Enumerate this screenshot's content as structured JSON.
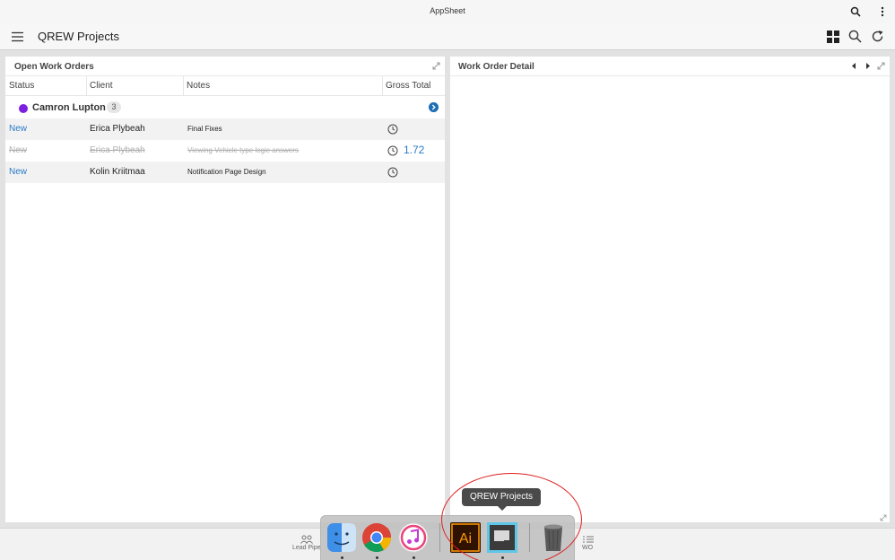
{
  "window": {
    "title": "AppSheet"
  },
  "header": {
    "app_title": "QREW Projects"
  },
  "left_panel": {
    "title": "Open Work Orders",
    "columns": [
      "Status",
      "Client",
      "Notes",
      "Gross Total"
    ],
    "group": {
      "name": "Camron Lupton",
      "count": "3",
      "color": "#7b1fe0"
    },
    "rows": [
      {
        "status": "New",
        "client": "Erica Plybeah",
        "notes": "Final Fixes",
        "gross": ""
      },
      {
        "status": "New",
        "client": "Erica Plybeah",
        "notes": "Viewing Vehicle type logic answers",
        "gross": "1.72"
      },
      {
        "status": "New",
        "client": "Kolin Kriitmaa",
        "notes": "Notification Page Design",
        "gross": ""
      }
    ]
  },
  "right_panel": {
    "title": "Work Order Detail"
  },
  "bottom_tabs": [
    {
      "label": "Lead Pipe",
      "icon": "people-icon"
    },
    {
      "label": "WO",
      "icon": "list-icon"
    }
  ],
  "dock": {
    "tooltip": "QREW Projects",
    "items": [
      {
        "name": "finder-icon"
      },
      {
        "name": "chrome-icon"
      },
      {
        "name": "itunes-icon"
      },
      {
        "name": "illustrator-icon",
        "label": "Ai"
      },
      {
        "name": "qrew-projects-icon"
      },
      {
        "name": "trash-icon"
      }
    ]
  },
  "colors": {
    "accent": "#2a7ac8",
    "annotation": "#e02020"
  }
}
